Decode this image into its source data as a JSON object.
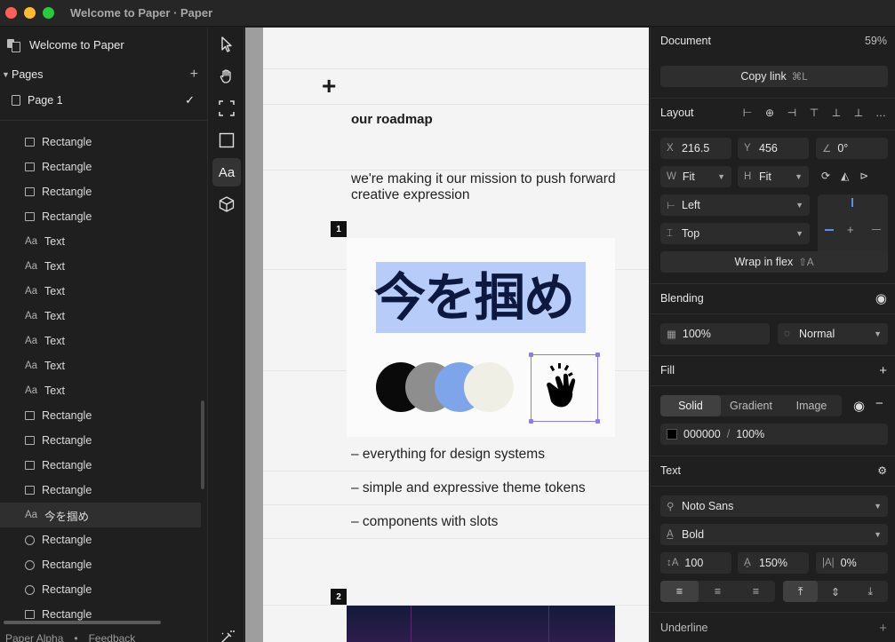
{
  "window": {
    "title": "Welcome to Paper · Paper"
  },
  "sidebar": {
    "file_name": "Welcome to Paper",
    "pages_label": "Pages",
    "pages": [
      {
        "label": "Page 1",
        "selected": true
      }
    ],
    "layers": [
      {
        "type": "rect",
        "label": "Rectangle"
      },
      {
        "type": "rect",
        "label": "Rectangle"
      },
      {
        "type": "rect",
        "label": "Rectangle"
      },
      {
        "type": "rect",
        "label": "Rectangle"
      },
      {
        "type": "text",
        "icon_text": "Aa",
        "label": "Text"
      },
      {
        "type": "text",
        "icon_text": "Aa",
        "label": "Text"
      },
      {
        "type": "text",
        "icon_text": "Aa",
        "label": "Text"
      },
      {
        "type": "text",
        "icon_text": "Aa",
        "label": "Text"
      },
      {
        "type": "text",
        "icon_text": "Aa",
        "label": "Text"
      },
      {
        "type": "text",
        "icon_text": "Aa",
        "label": "Text"
      },
      {
        "type": "text",
        "icon_text": "Aa",
        "label": "Text"
      },
      {
        "type": "rect",
        "label": "Rectangle"
      },
      {
        "type": "rect",
        "label": "Rectangle"
      },
      {
        "type": "rect",
        "label": "Rectangle"
      },
      {
        "type": "rect",
        "label": "Rectangle"
      },
      {
        "type": "text",
        "icon_text": "Aa",
        "label": "今を掴め",
        "selected": true
      },
      {
        "type": "circle",
        "label": "Rectangle"
      },
      {
        "type": "circle",
        "label": "Rectangle"
      },
      {
        "type": "circle",
        "label": "Rectangle"
      },
      {
        "type": "rect",
        "label": "Rectangle"
      }
    ],
    "footer": {
      "version": "Paper Alpha",
      "feedback": "Feedback"
    }
  },
  "toolbar": {
    "tools": [
      {
        "name": "select-tool",
        "icon": "arrow-icon"
      },
      {
        "name": "hand-tool",
        "icon": "hand-icon"
      },
      {
        "name": "frame-tool",
        "icon": "frame-icon"
      },
      {
        "name": "rectangle-tool",
        "icon": "rectangle-icon"
      },
      {
        "name": "text-tool",
        "icon": "text-icon",
        "label": "Aa",
        "active": true
      },
      {
        "name": "3d-tool",
        "icon": "cube-icon"
      },
      {
        "name": "magic-tool",
        "icon": "wand-icon"
      }
    ]
  },
  "canvas": {
    "heading": "our roadmap",
    "mission": "we're making it our mission to push forward creative expression",
    "section1_badge": "1",
    "section2_badge": "2",
    "hero_text": "今を掴め",
    "circle_colors": [
      "#0a0a0a",
      "#8e8e8e",
      "#7ea4ea",
      "#f0efe6"
    ],
    "highlight_color": "#b7ccf8",
    "bullets": [
      "– everything for design systems",
      "– simple and expressive theme tokens",
      "– components with slots"
    ]
  },
  "panel": {
    "document": {
      "label": "Document",
      "zoom": "59%"
    },
    "copy_link": {
      "label": "Copy link",
      "shortcut": "⌘L"
    },
    "layout": {
      "label": "Layout",
      "x": {
        "prefix": "X",
        "value": "216.5"
      },
      "y": {
        "prefix": "Y",
        "value": "456"
      },
      "rotation": {
        "prefix": "∠",
        "value": "0°"
      },
      "width": {
        "prefix": "W",
        "value": "Fit"
      },
      "height": {
        "prefix": "H",
        "value": "Fit"
      },
      "horizontal": "Left",
      "vertical": "Top",
      "wrap_label": "Wrap in flex",
      "wrap_shortcut": "⇧A"
    },
    "blending": {
      "label": "Blending",
      "opacity": "100%",
      "mode": "Normal"
    },
    "fill": {
      "label": "Fill",
      "tabs": [
        "Solid",
        "Gradient",
        "Image"
      ],
      "active_tab": "Solid",
      "hex": "000000",
      "separator": "/",
      "opacity": "100%",
      "color": "#000000"
    },
    "text": {
      "label": "Text",
      "font": "Noto Sans",
      "weight": "Bold",
      "size": "100",
      "line_height": "150%",
      "letter_spacing": "0%"
    },
    "underline": {
      "label": "Underline"
    }
  }
}
